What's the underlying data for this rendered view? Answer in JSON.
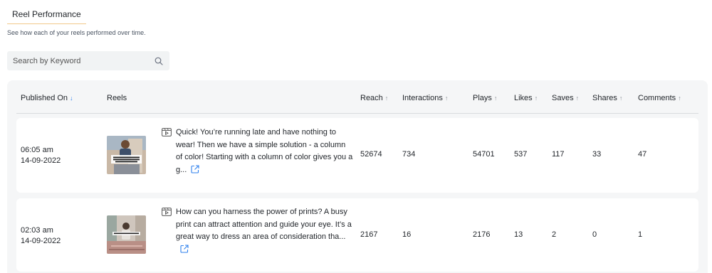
{
  "tab": {
    "label": "Reel Performance"
  },
  "subtitle": "See how each of your reels performed over time.",
  "search": {
    "placeholder": "Search by Keyword"
  },
  "columns": {
    "published_on": "Published On",
    "reels": "Reels",
    "reach": "Reach",
    "interactions": "Interactions",
    "plays": "Plays",
    "likes": "Likes",
    "saves": "Saves",
    "shares": "Shares",
    "comments": "Comments",
    "sort_active_arrow": "↓",
    "sort_arrow": "↑"
  },
  "rows": [
    {
      "time": "06:05 am",
      "date": "14-09-2022",
      "caption": "Quick! You’re running late and have nothing to wear! Then we have a simple solution - a column of color! Starting with a column of color gives you a g...",
      "thumb_text": "This is for you if you're not shopping with getting dressed",
      "reach": "52674",
      "interactions": "734",
      "plays": "54701",
      "likes": "537",
      "saves": "117",
      "shares": "33",
      "comments": "47"
    },
    {
      "time": "02:03 am",
      "date": "14-09-2022",
      "caption": "How can you harness the power of prints? A busy print can attract attention and guide your eye. It’s a great way to dress an area of consideration tha...",
      "reach": "2167",
      "interactions": "16",
      "plays": "2176",
      "likes": "13",
      "saves": "2",
      "shares": "0",
      "comments": "1"
    }
  ],
  "colors": {
    "accent": "#2f80ed",
    "tab_underline": "#f2c98a",
    "table_bg": "#f5f6f7"
  },
  "icons": {
    "search": "search-icon",
    "reel": "reel-icon",
    "external_link": "external-link-icon",
    "sort": "sort-arrow-icon"
  }
}
